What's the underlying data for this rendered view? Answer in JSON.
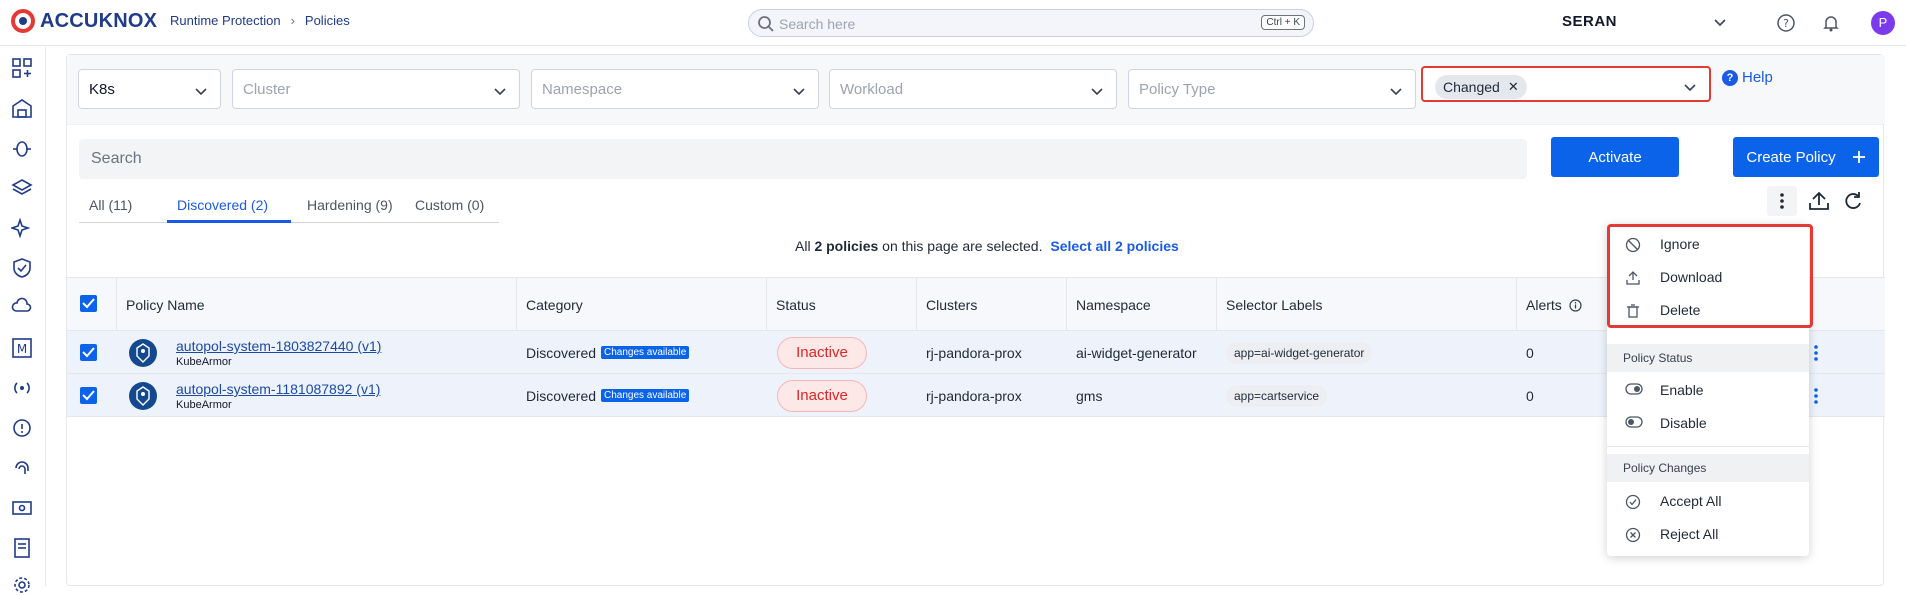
{
  "brand": {
    "name": "ACCUKNOX"
  },
  "breadcrumb": {
    "section": "Runtime Protection",
    "page": "Policies"
  },
  "top_search": {
    "placeholder": "Search here",
    "shortcut": "Ctrl + K"
  },
  "tenant": {
    "name": "SERAN"
  },
  "user": {
    "initial": "P"
  },
  "filters": {
    "platform": "K8s",
    "cluster": "Cluster",
    "namespace": "Namespace",
    "workload": "Workload",
    "policy_type": "Policy Type",
    "changed_chip": "Changed",
    "help": "Help"
  },
  "search": {
    "placeholder": "Search"
  },
  "actions": {
    "activate": "Activate",
    "create_policy": "Create Policy"
  },
  "tabs": [
    {
      "label": "All (11)"
    },
    {
      "label": "Discovered (2)"
    },
    {
      "label": "Hardening (9)"
    },
    {
      "label": "Custom (0)"
    }
  ],
  "selection": {
    "prefix": "All",
    "count": "2 policies",
    "suffix": "on this page are selected.",
    "select_all": "Select all 2 policies"
  },
  "table": {
    "headers": {
      "policy_name": "Policy Name",
      "category": "Category",
      "status": "Status",
      "clusters": "Clusters",
      "namespace": "Namespace",
      "selector_labels": "Selector Labels",
      "alerts": "Alerts"
    },
    "rows": [
      {
        "name": "autopol-system-1803827440 (v1)",
        "engine": "KubeArmor",
        "category": "Discovered",
        "badge": "Changes available",
        "status": "Inactive",
        "cluster": "rj-pandora-prox",
        "namespace": "ai-widget-generator",
        "label": "app=ai-widget-generator",
        "alerts": "0"
      },
      {
        "name": "autopol-system-1181087892 (v1)",
        "engine": "KubeArmor",
        "category": "Discovered",
        "badge": "Changes available",
        "status": "Inactive",
        "cluster": "rj-pandora-prox",
        "namespace": "gms",
        "label": "app=cartservice",
        "alerts": "0"
      }
    ]
  },
  "menu": {
    "ignore": "Ignore",
    "download": "Download",
    "delete": "Delete",
    "policy_status_header": "Policy Status",
    "enable": "Enable",
    "disable": "Disable",
    "policy_changes_header": "Policy Changes",
    "accept_all": "Accept All",
    "reject_all": "Reject All"
  },
  "colors": {
    "primary": "#0a63e8",
    "highlight": "#e53935",
    "inactive": "#dc2626",
    "brand": "#1f3b8a"
  }
}
